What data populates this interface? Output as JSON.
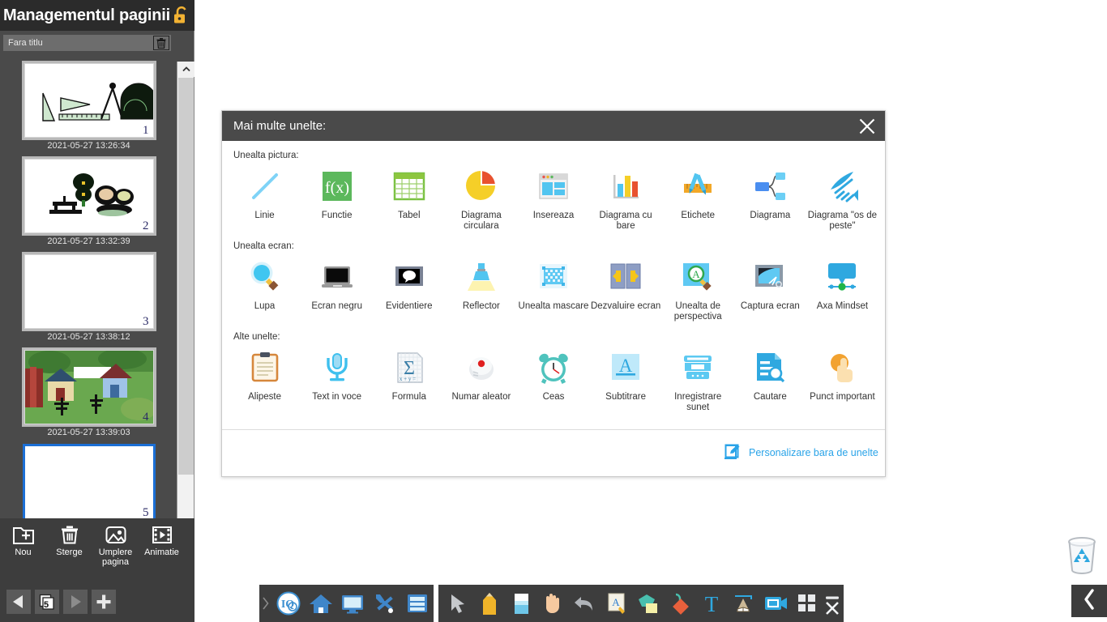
{
  "page_manager": {
    "title": "Managementul paginii",
    "lock_icon": "unlock-icon",
    "document_title": "Fara titlu",
    "delete_doc_icon": "trash-icon",
    "pages": [
      {
        "number": "1",
        "timestamp": "2021-05-27 13:26:34",
        "thumb": "geometry-tools"
      },
      {
        "number": "2",
        "timestamp": "2021-05-27 13:32:39",
        "thumb": "park-scene"
      },
      {
        "number": "3",
        "timestamp": "2021-05-27 13:38:12",
        "thumb": "blank"
      },
      {
        "number": "4",
        "timestamp": "2021-05-27 13:39:03",
        "thumb": "village-scene"
      },
      {
        "number": "5",
        "timestamp": "",
        "thumb": "blank-selected"
      }
    ],
    "tools": [
      {
        "label": "Nou",
        "icon": "new-folder-icon"
      },
      {
        "label": "Sterge",
        "icon": "trash-icon"
      },
      {
        "label": "Umplere pagina",
        "icon": "image-fill-icon"
      },
      {
        "label": "Animatie",
        "icon": "film-play-icon"
      }
    ],
    "nav": {
      "prev_icon": "arrow-left-icon",
      "page_count": "5",
      "next_icon": "arrow-right-icon",
      "add_icon": "plus-icon"
    },
    "scrollbar": {
      "up_icon": "chevron-up-icon",
      "down_icon": "chevron-down-icon"
    }
  },
  "dialog": {
    "title": "Mai multe unelte:",
    "close_icon": "close-icon",
    "sections": [
      {
        "label": "Unealta pictura:",
        "items": [
          {
            "label": "Linie",
            "icon": "line-icon"
          },
          {
            "label": "Functie",
            "icon": "function-fx-icon"
          },
          {
            "label": "Tabel",
            "icon": "table-icon"
          },
          {
            "label": "Diagrama circulara",
            "icon": "pie-chart-icon"
          },
          {
            "label": "Insereaza",
            "icon": "insert-window-icon"
          },
          {
            "label": "Diagrama cu bare",
            "icon": "bar-chart-icon"
          },
          {
            "label": "Etichete",
            "icon": "labels-ruler-pen-icon"
          },
          {
            "label": "Diagrama",
            "icon": "flow-diagram-icon"
          },
          {
            "label": "Diagrama \"os de peste\"",
            "icon": "fishbone-diagram-icon"
          }
        ]
      },
      {
        "label": "Unealta ecran:",
        "items": [
          {
            "label": "Lupa",
            "icon": "magnifier-icon"
          },
          {
            "label": "Ecran negru",
            "icon": "black-screen-icon"
          },
          {
            "label": "Evidentiere",
            "icon": "highlight-icon"
          },
          {
            "label": "Reflector",
            "icon": "spotlight-icon"
          },
          {
            "label": "Unealta mascare",
            "icon": "mask-tool-icon"
          },
          {
            "label": "Dezvaluire ecran",
            "icon": "screen-reveal-icon"
          },
          {
            "label": "Unealta de perspectiva",
            "icon": "perspective-tool-icon"
          },
          {
            "label": "Captura ecran",
            "icon": "screen-capture-icon"
          },
          {
            "label": "Axa Mindset",
            "icon": "mindset-axis-icon"
          }
        ]
      },
      {
        "label": "Alte unelte:",
        "items": [
          {
            "label": "Alipeste",
            "icon": "clipboard-paste-icon"
          },
          {
            "label": "Text in voce",
            "icon": "microphone-icon"
          },
          {
            "label": "Formula",
            "icon": "formula-sigma-icon"
          },
          {
            "label": "Numar aleator",
            "icon": "dice-random-icon"
          },
          {
            "label": "Ceas",
            "icon": "alarm-clock-icon"
          },
          {
            "label": "Subtitrare",
            "icon": "subtitle-icon"
          },
          {
            "label": "Inregistrare sunet",
            "icon": "sound-recorder-icon"
          },
          {
            "label": "Cautare",
            "icon": "search-document-icon"
          },
          {
            "label": "Punct important",
            "icon": "important-point-hand-icon"
          }
        ]
      }
    ],
    "footer": {
      "customize_label": "Personalizare bara de unelte",
      "customize_icon": "edit-pencil-square-icon"
    }
  },
  "bottom_toolbar_left": {
    "handle_icon": "chevron-right-icon",
    "items": [
      {
        "icon": "iq-logo-icon"
      },
      {
        "icon": "home-icon"
      },
      {
        "icon": "monitor-icon"
      },
      {
        "icon": "tools-wrench-icon"
      },
      {
        "icon": "drawer-icon"
      }
    ]
  },
  "bottom_toolbar_right": {
    "items": [
      {
        "icon": "cursor-arrow-icon"
      },
      {
        "icon": "pencil-icon"
      },
      {
        "icon": "eraser-icon"
      },
      {
        "icon": "hand-icon"
      },
      {
        "icon": "undo-icon"
      },
      {
        "icon": "text-annotate-icon"
      },
      {
        "icon": "shapes-icon"
      },
      {
        "icon": "tag-icon"
      },
      {
        "icon": "text-tool-icon"
      },
      {
        "icon": "book-easel-icon"
      },
      {
        "icon": "video-icon"
      },
      {
        "icon": "grid-apps-icon"
      }
    ],
    "minimize_icon": "minimize-icon",
    "close_icon": "close-icon"
  },
  "desktop": {
    "recycle_bin_icon": "recycle-bin-icon",
    "collapse_icon": "chevron-left-icon"
  },
  "colors": {
    "accent_blue": "#29a3e8",
    "panel_dark": "#3d3d3d",
    "titlebar_dark": "#2b2b2b",
    "dialog_header": "#4a4a4a"
  }
}
